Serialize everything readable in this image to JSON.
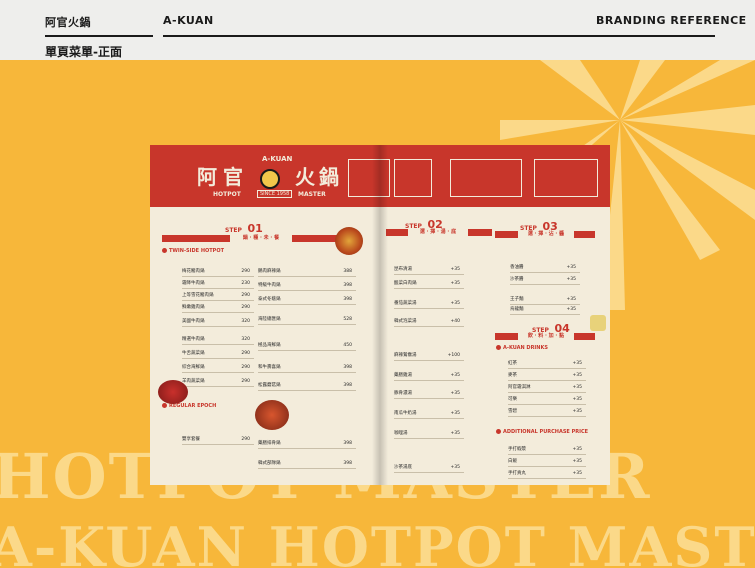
{
  "header": {
    "brand_cn": "阿官火鍋",
    "brand_en": "A-KUAN",
    "reference": "BRANDING REFERENCE",
    "subtitle": "單頁菜單-正面"
  },
  "background_text": {
    "line1": "HOTPOT MASTER",
    "line2": "A-KUAN HOTPOT MASTER"
  },
  "menu": {
    "logo_left": "阿官",
    "logo_right": "火鍋",
    "logo_en": "A-KUAN",
    "hotpot": "HOTPOT",
    "master": "MASTER",
    "since": "SINCE 1958",
    "step_label": "STEP",
    "steps": [
      {
        "num": "01",
        "band": "鍋 · 種 · 未 · 餐"
      },
      {
        "num": "02",
        "band": "選 · 擇 · 湯 · 底"
      },
      {
        "num": "03",
        "band": "選 · 擇 · 沾 · 醬"
      },
      {
        "num": "04",
        "band": "飲 · 料 · 加 · 點"
      }
    ],
    "sections": {
      "twin": "TWIN-SIDE HOTPOT",
      "regular": "REGULAR EPOCH",
      "drinks": "A-KUAN DRINKS",
      "additional": "ADDITIONAL PURCHASE PRICE"
    },
    "left_rows": [
      {
        "name": "梅花豬肉鍋",
        "price": "290"
      },
      {
        "name": "霜降牛肉鍋",
        "price": "230"
      },
      {
        "name": "上等雪花豬肉鍋",
        "price": "290"
      },
      {
        "name": "鮮嫩雞肉鍋",
        "price": "290"
      },
      {
        "name": "美國牛肉鍋",
        "price": "320"
      },
      {
        "name": "精選牛肉鍋",
        "price": "320"
      },
      {
        "name": "牛舌蔬菜鍋",
        "price": "290"
      },
      {
        "name": "綜合海鮮鍋",
        "price": "290"
      },
      {
        "name": "羊肉蔬菜鍋",
        "price": "290"
      },
      {
        "name": "雙享套餐",
        "price": "290"
      }
    ],
    "mid_rows": [
      {
        "name": "鵝肉麻辣鍋",
        "price": "388"
      },
      {
        "name": "特級牛肉鍋",
        "price": "398"
      },
      {
        "name": "泰式冬蔭鍋",
        "price": "398"
      },
      {
        "name": "海陸總匯鍋",
        "price": "528"
      },
      {
        "name": "極品海鮮鍋",
        "price": "450"
      },
      {
        "name": "和牛壽喜鍋",
        "price": "398"
      },
      {
        "name": "松露蘑菇鍋",
        "price": "398"
      },
      {
        "name": "藥膳排骨鍋",
        "price": "398"
      },
      {
        "name": "韓式部隊鍋",
        "price": "398"
      }
    ],
    "right_rows": [
      {
        "name": "昆布清湯",
        "price": "+35"
      },
      {
        "name": "酸菜白肉鍋",
        "price": "+35"
      },
      {
        "name": "番茄蔬菜湯",
        "price": "+35"
      },
      {
        "name": "韓式泡菜湯",
        "price": "+40"
      },
      {
        "name": "麻辣鴛鴦湯",
        "price": "+100"
      },
      {
        "name": "藥膳雞湯",
        "price": "+35"
      },
      {
        "name": "豚骨濃湯",
        "price": "+35"
      },
      {
        "name": "南瓜牛奶湯",
        "price": "+35"
      },
      {
        "name": "咖哩湯",
        "price": "+35"
      },
      {
        "name": "沙茶湯底",
        "price": "+35"
      }
    ],
    "far_rows": [
      {
        "name": "香油醬",
        "price": "+35"
      },
      {
        "name": "沙茶醬",
        "price": "+35"
      },
      {
        "name": "王子麵",
        "price": "+35"
      },
      {
        "name": "烏龍麵",
        "price": "+35"
      },
      {
        "name": "紅茶",
        "price": "+35"
      },
      {
        "name": "麥茶",
        "price": "+35"
      },
      {
        "name": "阿官霜淇淋",
        "price": "+35"
      },
      {
        "name": "可樂",
        "price": "+35"
      },
      {
        "name": "雪碧",
        "price": "+35"
      },
      {
        "name": "手打蝦漿",
        "price": "+35"
      },
      {
        "name": "白飯",
        "price": "+35"
      },
      {
        "name": "手打貢丸",
        "price": "+35"
      }
    ]
  }
}
